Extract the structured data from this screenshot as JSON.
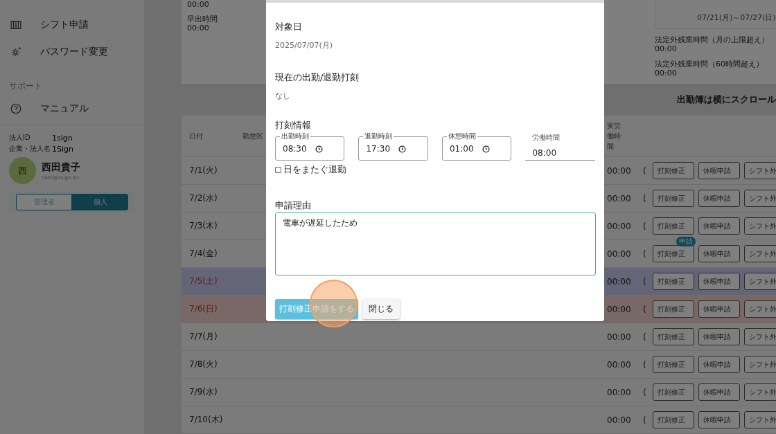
{
  "sidebar": {
    "menu": [
      {
        "kind": "link",
        "label": "シフト申請"
      },
      {
        "kind": "link",
        "label": "パスワード変更"
      },
      {
        "kind": "section",
        "label": "サポート"
      },
      {
        "kind": "link",
        "label": "マニュアル"
      }
    ]
  },
  "account": {
    "fields": [
      {
        "label": "法人ID",
        "value": "1sign"
      },
      {
        "label": "企業・法人名",
        "value": "1Sign"
      }
    ],
    "avatar": "西",
    "name": "西田貴子",
    "email": "nishi@1sign.inc",
    "roles": [
      {
        "label": "管理者",
        "selected": false
      },
      {
        "label": "個人",
        "selected": true
      }
    ]
  },
  "summary": {
    "items": [
      {
        "value": "00:00"
      },
      {
        "label": "早出時間",
        "value": "00:00"
      }
    ],
    "weeks": [
      "07/21(月)～07/27(日)"
    ],
    "overtime": [
      {
        "label": "法定外残業時間（月の上限超え）",
        "value": "00:00"
      },
      {
        "label": "法定外残業時間（60時間超え）",
        "value": "00:00"
      }
    ]
  },
  "scroll_hint": "出勤簿は横にスクロール",
  "table": {
    "columns": [
      "日付",
      "勤怠区",
      "実労働時間"
    ],
    "rows": [
      {
        "date": "7/1(火)",
        "kind": "weekday",
        "actual": "00:00",
        "column_4": "(",
        "actions": [
          "打刻修正",
          "休暇申請",
          "シフト外"
        ]
      },
      {
        "date": "7/2(水)",
        "kind": "weekday",
        "actual": "00:00",
        "column_4": "(",
        "actions": [
          "打刻修正",
          "休暇申請",
          "シフト外"
        ]
      },
      {
        "date": "7/3(木)",
        "kind": "weekday",
        "actual": "00:00",
        "column_4": "(",
        "actions": [
          "打刻修正",
          "休暇申請",
          "シフト外"
        ]
      },
      {
        "date": "7/4(金)",
        "kind": "weekday",
        "actual": "00:00",
        "column_4": "(",
        "actions": [
          "打刻修正",
          "休暇申請",
          "シフト外"
        ],
        "badge": "申請"
      },
      {
        "date": "7/5(土)",
        "kind": "saturday",
        "actual": "00:00",
        "column_4": "(",
        "actions": [
          "打刻修正",
          "休暇申請",
          "シフト外"
        ]
      },
      {
        "date": "7/6(日)",
        "kind": "sunday",
        "actual": "00:00",
        "column_4": "(",
        "actions": [
          "打刻修正",
          "休暇申請",
          "シフト外"
        ]
      },
      {
        "date": "7/7(月)",
        "kind": "weekday",
        "actual": "00:00",
        "column_4": "(",
        "actions": [
          "打刻修正",
          "休暇申請",
          "シフト外"
        ]
      },
      {
        "date": "7/8(火)",
        "kind": "weekday",
        "actual": "00:00",
        "column_4": "(",
        "actions": [
          "打刻修正",
          "休暇申請",
          "シフト外"
        ]
      },
      {
        "date": "7/9(水)",
        "kind": "weekday",
        "actual": "00:00",
        "column_4": "(",
        "actions": [
          "打刻修正",
          "休暇申請",
          "シフト外"
        ]
      },
      {
        "date": "7/10(木)",
        "kind": "weekday",
        "actual": "00:00",
        "column_4": "(",
        "actions": [
          "打刻修正",
          "休暇申請",
          "シフト外"
        ]
      }
    ]
  },
  "modal": {
    "target_label": "対象日",
    "target_date": "2025/07/07(月)",
    "current_label": "現在の出勤/退勤打刻",
    "current_value": "なし",
    "stamp_label": "打刻情報",
    "times": [
      {
        "kind": "time",
        "label": "出勤時刻",
        "value": "08:30"
      },
      {
        "kind": "time",
        "label": "退勤時刻",
        "value": "17:30"
      },
      {
        "kind": "time",
        "label": "休憩時間",
        "value": "01:00"
      },
      {
        "kind": "readonly",
        "label": "労働時間",
        "value": "08:00"
      }
    ],
    "overnight": {
      "label": "日をまたぐ退勤",
      "checked": false
    },
    "reason_label": "申請理由",
    "reason": "電車が遅延したため",
    "submit": "打刻修正申請をする",
    "close": "閉じる"
  }
}
